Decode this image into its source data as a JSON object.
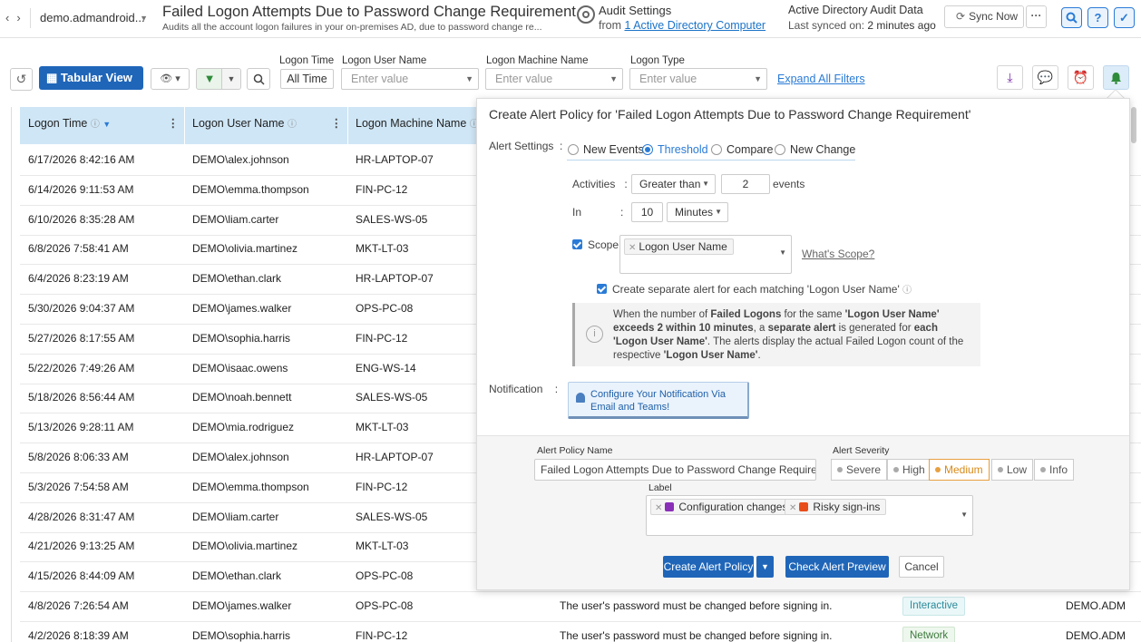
{
  "nav": {
    "back": "‹",
    "forward": "›"
  },
  "domain": {
    "value": "demo.admandroid..."
  },
  "header": {
    "title": "Failed Logon Attempts Due to Password Change Requirement",
    "subtitle": "Audits all the account logon failures in your on-premises AD, due to password change re..."
  },
  "audit_settings": {
    "title": "Audit Settings",
    "from_prefix": "from",
    "from_link": "1 Active Directory Computer"
  },
  "sync": {
    "title": "Active Directory Audit Data",
    "synced_prefix": "Last synced on:",
    "synced_value": "2 minutes ago",
    "button": "Sync Now",
    "more": "···"
  },
  "toolbar": {
    "view_label": "Tabular View",
    "filters": [
      {
        "label": "Logon Time",
        "value": "All Time"
      },
      {
        "label": "Logon User Name",
        "placeholder": "Enter value"
      },
      {
        "label": "Logon Machine Name",
        "placeholder": "Enter value"
      },
      {
        "label": "Logon Type",
        "placeholder": "Enter value"
      }
    ],
    "expand_filters": "Expand All Filters"
  },
  "table": {
    "columns": [
      "Logon Time",
      "Logon User Name",
      "Logon Machine Name"
    ],
    "rows": [
      {
        "time": "6/17/2026 8:42:16 AM",
        "user": "DEMO\\alex.johnson",
        "machine": "HR-LAPTOP-07"
      },
      {
        "time": "6/14/2026 9:11:53 AM",
        "user": "DEMO\\emma.thompson",
        "machine": "FIN-PC-12"
      },
      {
        "time": "6/10/2026 8:35:28 AM",
        "user": "DEMO\\liam.carter",
        "machine": "SALES-WS-05"
      },
      {
        "time": "6/8/2026 7:58:41 AM",
        "user": "DEMO\\olivia.martinez",
        "machine": "MKT-LT-03"
      },
      {
        "time": "6/4/2026 8:23:19 AM",
        "user": "DEMO\\ethan.clark",
        "machine": "HR-LAPTOP-07"
      },
      {
        "time": "5/30/2026 9:04:37 AM",
        "user": "DEMO\\james.walker",
        "machine": "OPS-PC-08"
      },
      {
        "time": "5/27/2026 8:17:55 AM",
        "user": "DEMO\\sophia.harris",
        "machine": "FIN-PC-12"
      },
      {
        "time": "5/22/2026 7:49:26 AM",
        "user": "DEMO\\isaac.owens",
        "machine": "ENG-WS-14"
      },
      {
        "time": "5/18/2026 8:56:44 AM",
        "user": "DEMO\\noah.bennett",
        "machine": "SALES-WS-05"
      },
      {
        "time": "5/13/2026 9:28:11 AM",
        "user": "DEMO\\mia.rodriguez",
        "machine": "MKT-LT-03"
      },
      {
        "time": "5/8/2026 8:06:33 AM",
        "user": "DEMO\\alex.johnson",
        "machine": "HR-LAPTOP-07"
      },
      {
        "time": "5/3/2026 7:54:58 AM",
        "user": "DEMO\\emma.thompson",
        "machine": "FIN-PC-12"
      },
      {
        "time": "4/28/2026 8:31:47 AM",
        "user": "DEMO\\liam.carter",
        "machine": "SALES-WS-05"
      },
      {
        "time": "4/21/2026 9:13:25 AM",
        "user": "DEMO\\olivia.martinez",
        "machine": "MKT-LT-03"
      },
      {
        "time": "4/15/2026 8:44:09 AM",
        "user": "DEMO\\ethan.clark",
        "machine": "OPS-PC-08"
      },
      {
        "time": "4/8/2026 7:26:54 AM",
        "user": "DEMO\\james.walker",
        "machine": "OPS-PC-08",
        "reason": "The user's password must be changed before signing in.",
        "type": "Interactive",
        "domain": "DEMO.ADM"
      },
      {
        "time": "4/2/2026 8:18:39 AM",
        "user": "DEMO\\sophia.harris",
        "machine": "FIN-PC-12",
        "reason": "The user's password must be changed before signing in.",
        "type": "Network",
        "domain": "DEMO.ADM"
      }
    ]
  },
  "alert_panel": {
    "title": "Create Alert Policy for 'Failed Logon Attempts Due to Password Change Requirement'",
    "settings_label": "Alert Settings",
    "modes": [
      "New Events",
      "Threshold",
      "Compare",
      "New Change"
    ],
    "selected_mode": "Threshold",
    "activities_label": "Activities",
    "operator": "Greater than",
    "count": "2",
    "events_label": "events",
    "in_label": "In",
    "period_value": "10",
    "period_unit": "Minutes",
    "scope_label": "Scope",
    "scope_tag": "Logon User Name",
    "whats_scope": "What's Scope?",
    "separate_alert": "Create separate alert for each matching 'Logon User Name'",
    "info_text": {
      "p1": "When the number of ",
      "b1": "Failed Logons",
      "p2": " for the same ",
      "b2": "'Logon User Name' exceeds 2 within 10 minutes",
      "p3": ", a ",
      "b3": "separate alert",
      "p4": " is generated for ",
      "b4": "each 'Logon User Name'",
      "p5": ". The alerts display the actual Failed Logon count of the respective ",
      "b5": "'Logon User Name'",
      "p6": "."
    },
    "notification_label": "Notification",
    "notification_btn_l1": "Configure Your Notification Via",
    "notification_btn_l2": "Email and Teams!",
    "policy_name_label": "Alert Policy Name",
    "policy_name_value": "Failed Logon Attempts Due to Password Change Requireme",
    "severity_label": "Alert Severity",
    "severities": [
      "Severe",
      "High",
      "Medium",
      "Low",
      "Info"
    ],
    "selected_severity": "Medium",
    "label_label": "Label",
    "labels": [
      {
        "name": "Configuration changes",
        "color": "#8a2fb8"
      },
      {
        "name": "Risky sign-ins",
        "color": "#e84d1a"
      }
    ],
    "create_btn": "Create Alert Policy",
    "preview_btn": "Check Alert Preview",
    "cancel_btn": "Cancel"
  },
  "colors": {
    "primary": "#1f66b9",
    "link": "#2a7bd6",
    "header_row": "#cfe6f6"
  }
}
